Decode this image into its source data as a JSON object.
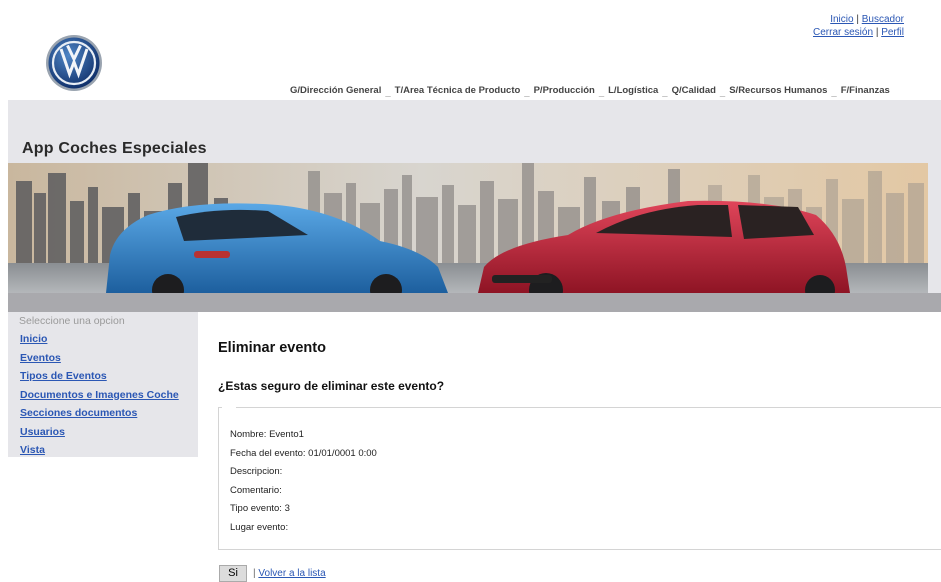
{
  "top_links": {
    "inicio": "Inicio",
    "sep1": "|",
    "buscador": "Buscador",
    "cerrar_sesion": "Cerrar sesión",
    "sep2": "|",
    "perfil": "Perfil"
  },
  "dept_nav": [
    "G/Dirección General",
    "T/Area Técnica de Producto",
    "P/Producción",
    "L/Logística",
    "Q/Calidad",
    "S/Recursos Humanos",
    "F/Finanzas"
  ],
  "dept_sep": "_",
  "app_title": "App Coches Especiales",
  "sidebar": {
    "hint": "Seleccione una opcion",
    "items": [
      "Inicio",
      "Eventos",
      "Tipos de Eventos",
      "Documentos e Imagenes Coche",
      "Secciones documentos",
      "Usuarios",
      "Vista"
    ]
  },
  "main": {
    "title": "Eliminar evento",
    "question": "¿Estas seguro de eliminar este evento?",
    "details": [
      "Nombre: Evento1",
      "Fecha del evento: 01/01/0001 0:00",
      "Descripcion:",
      "Comentario:",
      "Tipo evento: 3",
      "Lugar evento:"
    ],
    "confirm_button": "Si",
    "separator": "|",
    "back_link": "Volver a la lista"
  },
  "colors": {
    "link": "#2b57b4",
    "band": "#e6e6ea",
    "bar": "#a9a9ad",
    "car_blue": "#2f86cf",
    "car_red": "#c8243a"
  }
}
